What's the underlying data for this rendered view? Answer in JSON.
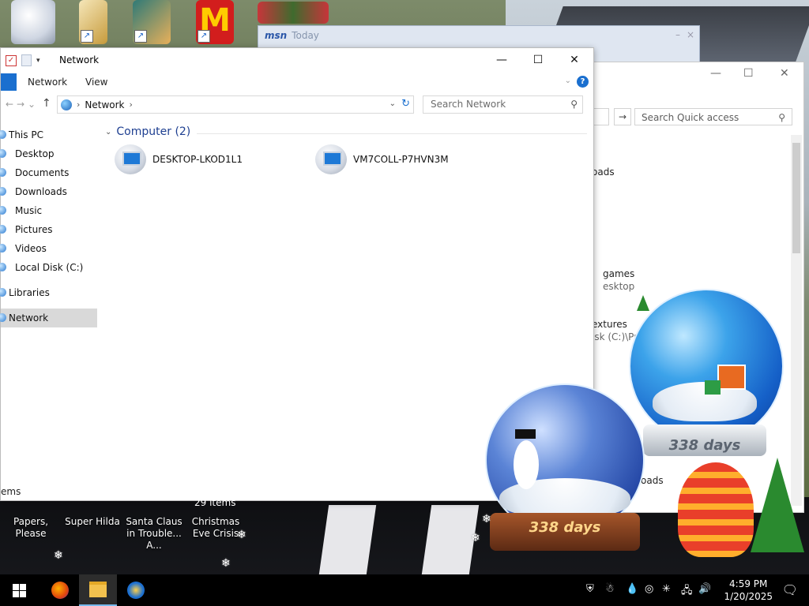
{
  "top_icons": [
    {
      "name": "network-icon"
    },
    {
      "name": "media-icon"
    },
    {
      "name": "game-icon"
    },
    {
      "name": "mcdonalds-icon"
    }
  ],
  "msn": {
    "logo": "msn",
    "title": "Today",
    "min": "–",
    "close": "×"
  },
  "bg_window": {
    "minimize": "—",
    "maximize": "☐",
    "close": "✕",
    "search_placeholder": "Search Quick access",
    "nav_arrow": "→",
    "items": [
      {
        "text": "oads",
        "sub": ""
      },
      {
        "text": "games",
        "sub": "esktop"
      },
      {
        "text": "extures",
        "sub": "isk (C:)\\Pr..."
      },
      {
        "text": "oads",
        "sub": ""
      }
    ]
  },
  "window": {
    "title": "Network",
    "minimize": "—",
    "maximize": "☐",
    "close": "✕",
    "ribbon": {
      "tabs": [
        "Network",
        "View"
      ],
      "help": "?"
    },
    "address": {
      "back": "←",
      "forward": "→",
      "recent": "⌄",
      "up": "↑",
      "path": "Network",
      "search_placeholder": "Search Network"
    },
    "nav": {
      "this_pc": "This PC",
      "items": [
        "Desktop",
        "Documents",
        "Downloads",
        "Music",
        "Pictures",
        "Videos",
        "Local Disk (C:)"
      ],
      "libraries": "Libraries",
      "network": "Network"
    },
    "group": {
      "label": "Computer (2)"
    },
    "computers": [
      "DESKTOP-LKOD1L1",
      "VM7COLL-P7HVN3M"
    ],
    "status": "ems"
  },
  "bottom_icons": [
    {
      "label": "Papers, Please"
    },
    {
      "label": "Super Hilda"
    },
    {
      "label": "Santa Claus in Trouble... A..."
    },
    {
      "label": "Christmas Eve Crisis"
    }
  ],
  "bg_status": "29 items",
  "globes": [
    {
      "days": "338 days"
    },
    {
      "days": "338 days"
    }
  ],
  "taskbar": {
    "time": "4:59 PM",
    "date": "1/20/2025"
  },
  "colors": {
    "accent": "#1a6fcf",
    "group_header": "#1e3f91",
    "nav_selected": "#d9d9d9"
  }
}
